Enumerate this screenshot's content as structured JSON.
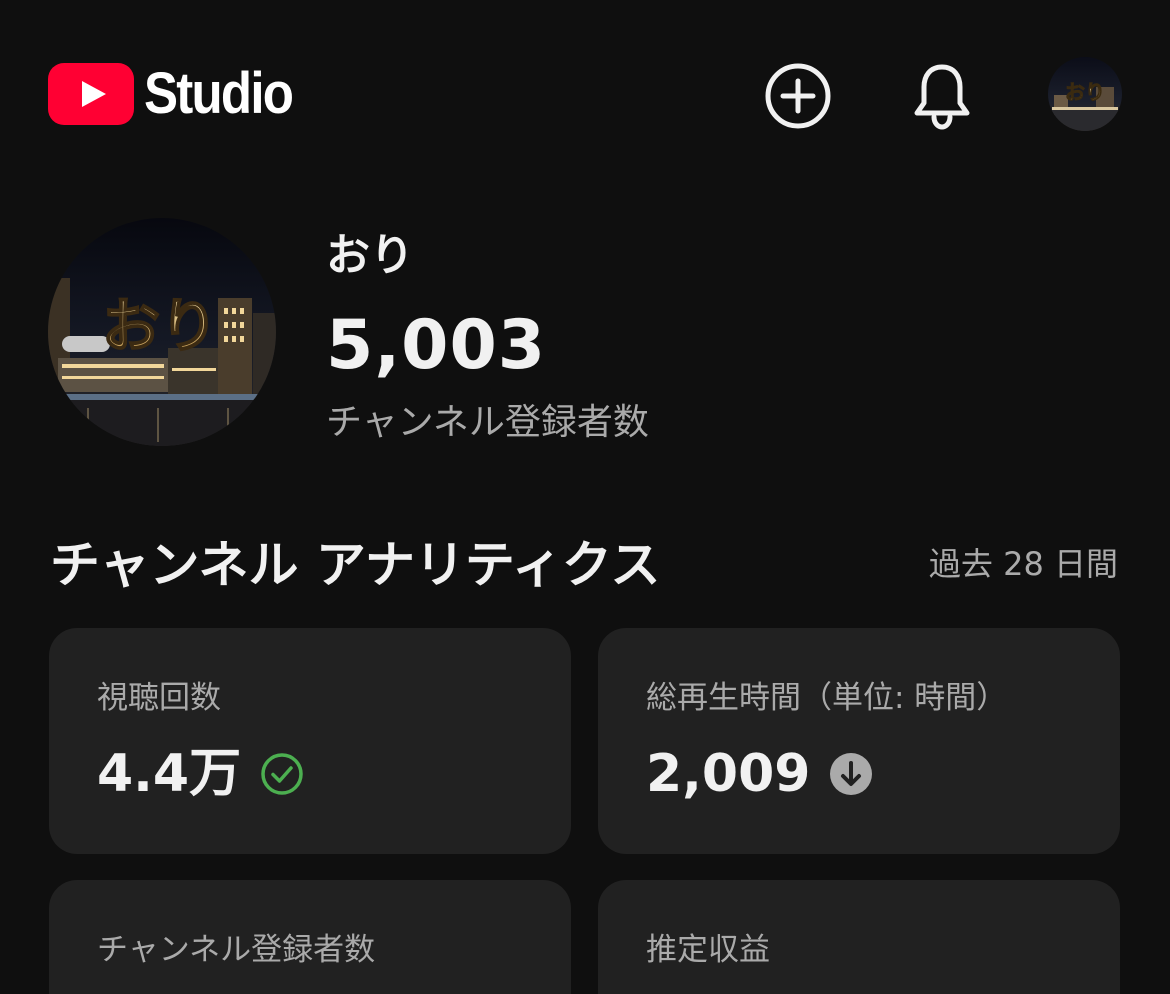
{
  "header": {
    "logo_text": "Studio",
    "brand_color": "#ff0033"
  },
  "channel": {
    "name": "おり",
    "avatar_text": "おり",
    "subscriber_count": "5,003",
    "subscriber_label": "チャンネル登録者数"
  },
  "analytics": {
    "title": "チャンネル アナリティクス",
    "period": "過去 28 日間",
    "cards": [
      {
        "label": "視聴回数",
        "value": "4.4万",
        "status_icon": "check-circle-icon",
        "status_color": "#4caf50"
      },
      {
        "label": "総再生時間（単位: 時間）",
        "value": "2,009",
        "status_icon": "arrow-down-circle-icon",
        "status_color": "#aaaaaa"
      },
      {
        "label": "チャンネル登録者数",
        "value": ""
      },
      {
        "label": "推定収益",
        "value": ""
      }
    ]
  }
}
